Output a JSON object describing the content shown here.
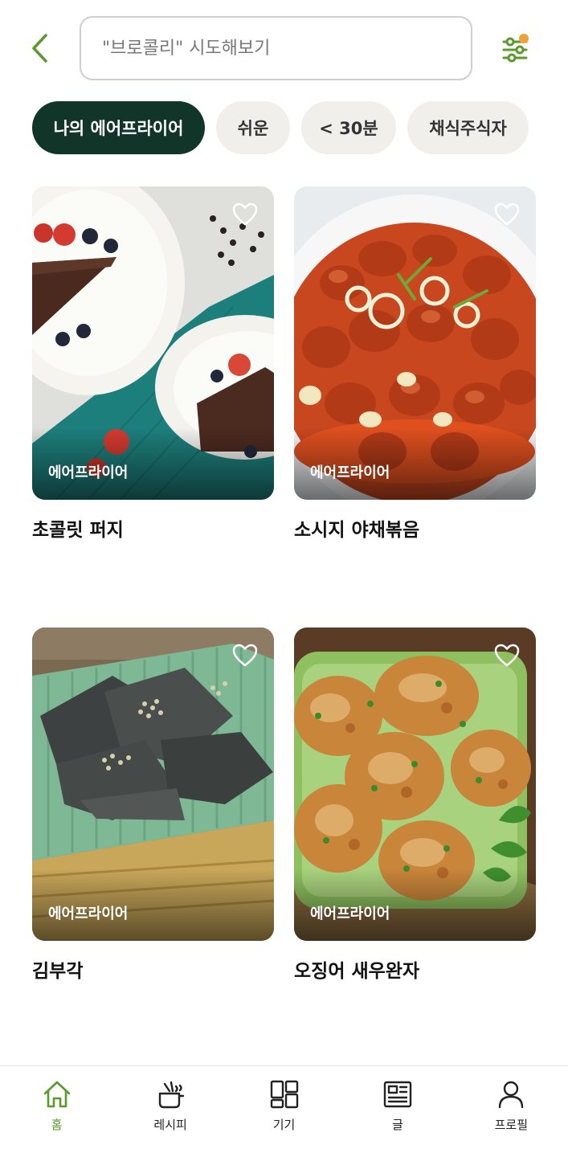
{
  "search": {
    "placeholder": "\"브로콜리\" 시도해보기"
  },
  "colors": {
    "accent": "#5a9a2e",
    "chip_active_bg": "#12352a",
    "chip_bg": "#f1efec",
    "filter_badge": "#f0a23a"
  },
  "chips": [
    {
      "label": "나의 에어프라이어",
      "active": true
    },
    {
      "label": "쉬운",
      "active": false
    },
    {
      "label": "< 30분",
      "active": false
    },
    {
      "label": "채식주식자",
      "active": false
    }
  ],
  "recipes": [
    {
      "title": "초콜릿 퍼지",
      "tag": "에어프라이어",
      "image": "chocolate-fudge-plates"
    },
    {
      "title": "소시지 야채볶음",
      "tag": "에어프라이어",
      "image": "sausage-stirfry"
    },
    {
      "title": "김부각",
      "tag": "에어프라이어",
      "image": "seaweed-chips"
    },
    {
      "title": "오징어 새우완자",
      "tag": "에어프라이어",
      "image": "squid-shrimp-patties"
    }
  ],
  "nav": [
    {
      "label": "홈",
      "icon": "home-icon",
      "active": true
    },
    {
      "label": "레시피",
      "icon": "pot-icon",
      "active": false
    },
    {
      "label": "기기",
      "icon": "grid-icon",
      "active": false
    },
    {
      "label": "글",
      "icon": "article-icon",
      "active": false
    },
    {
      "label": "프로필",
      "icon": "person-icon",
      "active": false
    }
  ]
}
